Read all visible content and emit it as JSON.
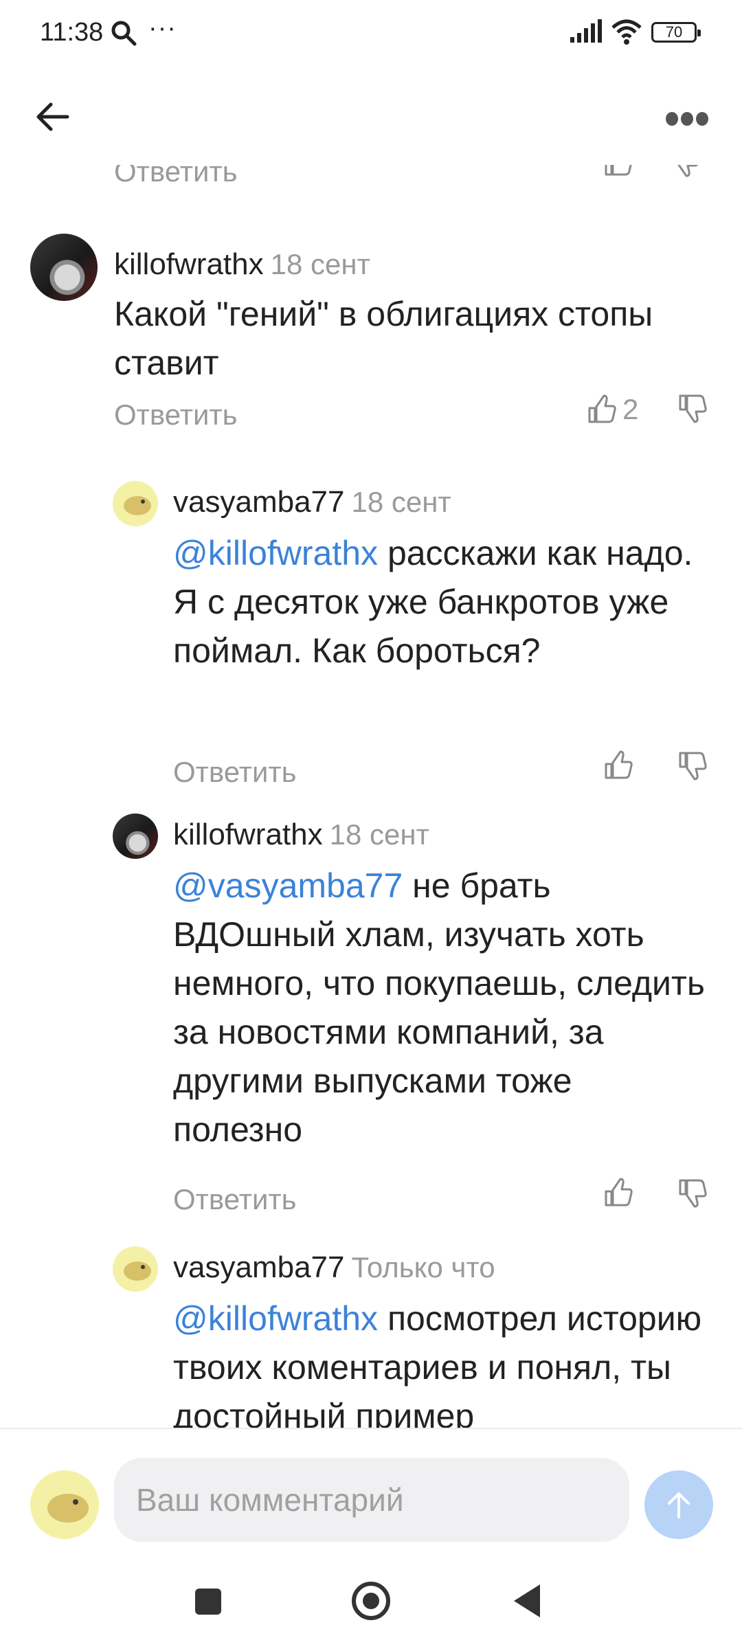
{
  "status_bar": {
    "time": "11:38",
    "overflow": "···",
    "battery": "70"
  },
  "header": {
    "back_icon": "arrow-left-icon",
    "more_icon": "more-dots-icon"
  },
  "comments": [
    {
      "user": "killofwrathx",
      "date": "18 сент",
      "text": "Какой \"гений\" в облигациях стопы ставит",
      "mention": "",
      "reply": "Ответить",
      "likes": "2",
      "avatar": "photo"
    },
    {
      "user": "vasyamba77",
      "date": "18 сент",
      "mention": "@killofwrathx",
      "text": " расскажи как надо. Я с десяток уже банкротов уже поймал. Как бороться?",
      "reply": "Ответить",
      "likes": "",
      "avatar": "capybara"
    },
    {
      "user": "killofwrathx",
      "date": "18 сент",
      "mention": "@vasyamba77",
      "text": " не брать ВДОшный хлам, изучать хоть немного, что покупаешь, следить за новостями компаний, за другими выпусками тоже полезно",
      "reply": "Ответить",
      "likes": "",
      "avatar": "photo"
    },
    {
      "user": "vasyamba77",
      "date": "Только что",
      "mention": "@killofwrathx",
      "text": " посмотрел историю твоих коментариев и понял, ты достойный пример",
      "reply": "",
      "likes": "",
      "avatar": "capybara"
    }
  ],
  "top_partial_reply": "Ответить",
  "composer": {
    "placeholder": "Ваш комментарий"
  },
  "colors": {
    "accent": "#3b82d9",
    "muted": "#9a9a9a",
    "send_disabled": "#b7d4f7"
  }
}
